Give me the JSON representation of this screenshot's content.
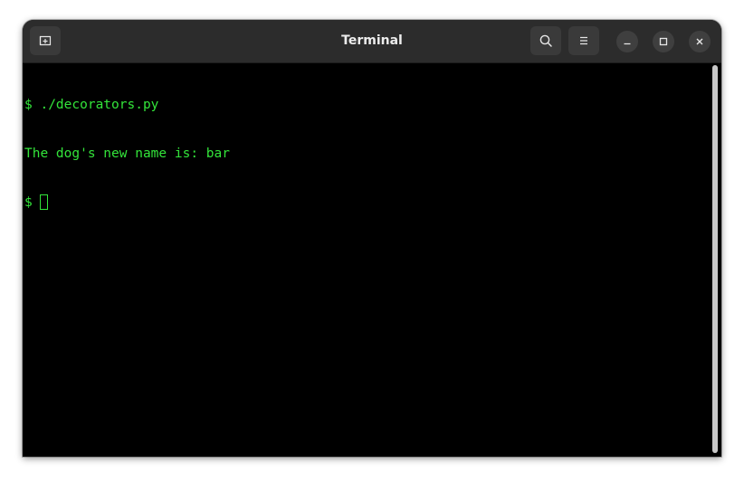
{
  "window": {
    "title": "Terminal"
  },
  "header": {
    "new_tab_icon": "new-tab-icon",
    "search_icon": "search-icon",
    "menu_icon": "hamburger-menu-icon",
    "minimize_icon": "minimize-icon",
    "maximize_icon": "maximize-icon",
    "close_icon": "close-icon"
  },
  "terminal": {
    "lines": [
      {
        "prompt": "$",
        "text": " ./decorators.py"
      },
      {
        "prompt": "",
        "text": "The dog's new name is: bar"
      },
      {
        "prompt": "$",
        "text": " "
      }
    ],
    "text_color": "#33e43a",
    "background": "#000000"
  }
}
